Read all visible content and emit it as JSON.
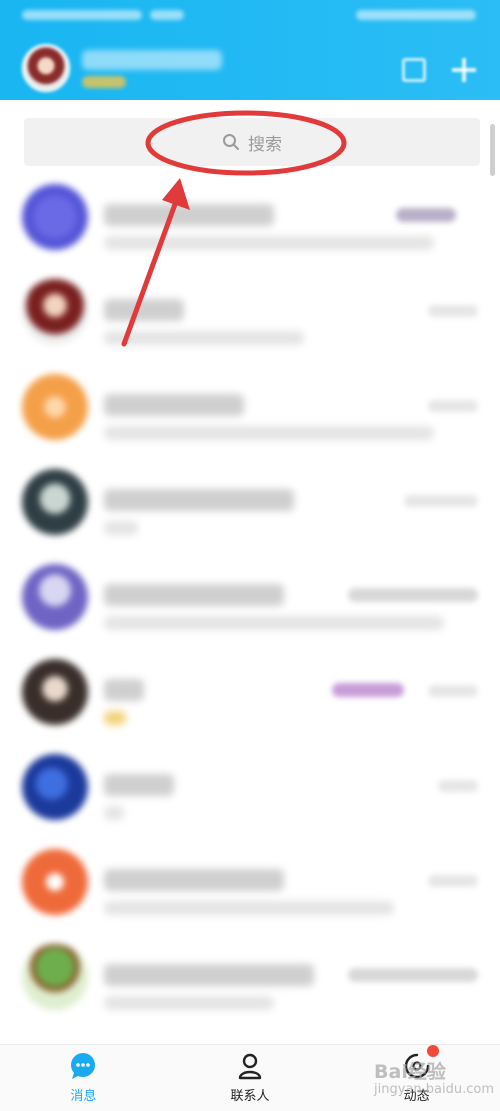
{
  "search": {
    "placeholder": "搜索"
  },
  "bottom_nav": {
    "items": [
      {
        "label": "消息",
        "active": true
      },
      {
        "label": "联系人",
        "active": false
      },
      {
        "label": "动态",
        "active": false
      }
    ]
  },
  "watermark": {
    "text": "Bai",
    "suffix": "经验",
    "sub": "jingyan.baidu.com"
  },
  "colors": {
    "header": "#1fb8f3",
    "accent": "#1aaaf0",
    "annotation": "#e03a3a",
    "badge": "#f04a3a"
  },
  "icons": {
    "search": "search-icon",
    "message": "message-icon",
    "contacts": "contacts-icon",
    "activity": "activity-icon"
  }
}
